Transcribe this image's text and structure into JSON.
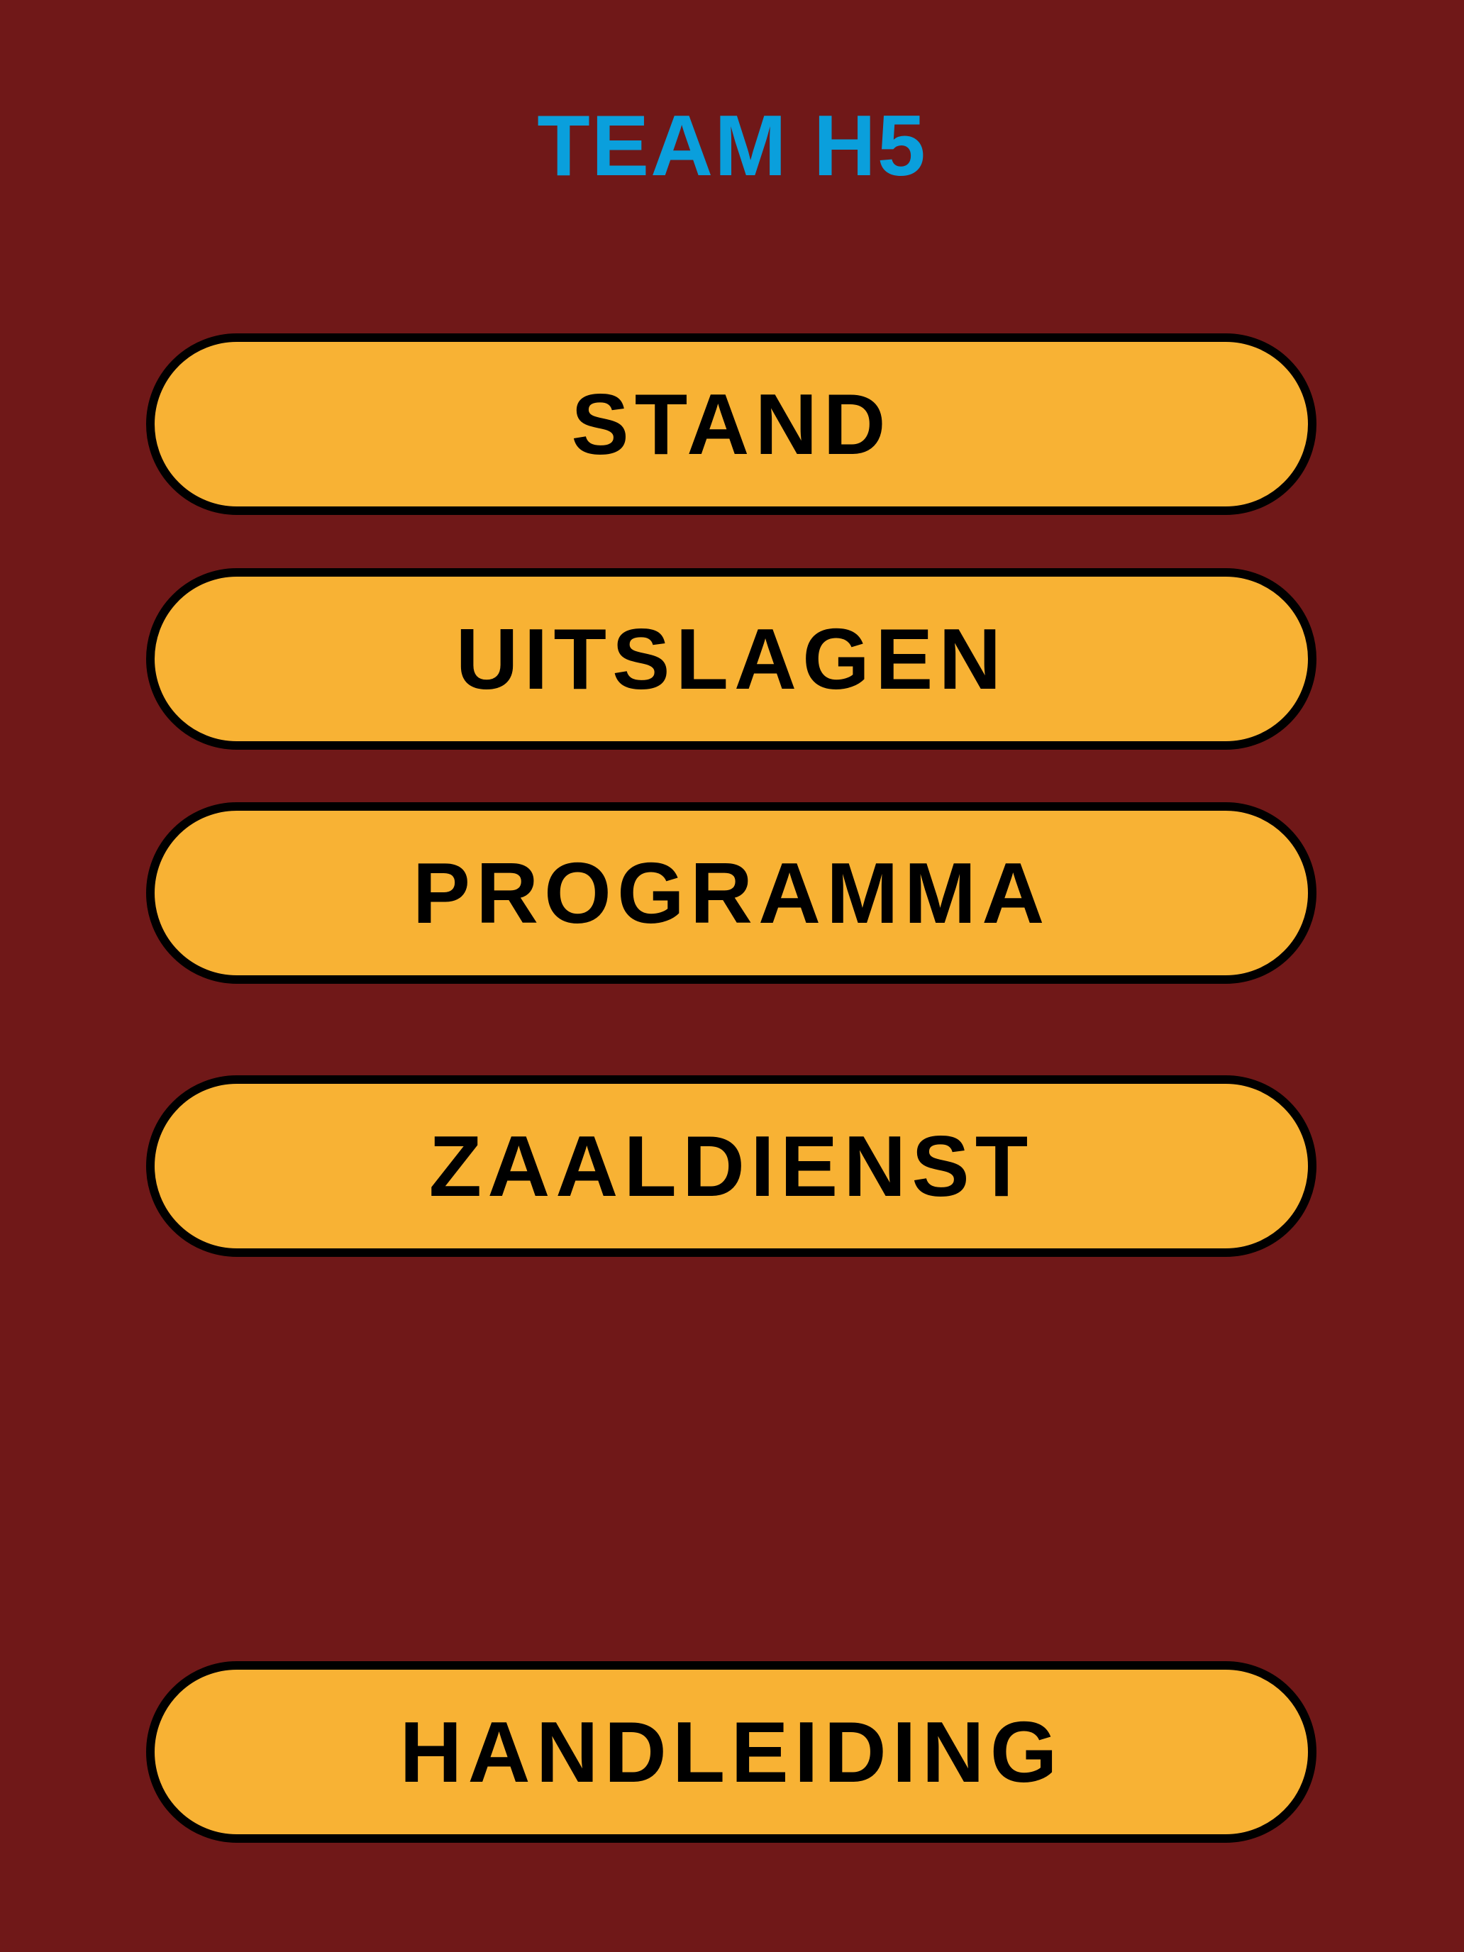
{
  "header": {
    "title": "TEAM H5"
  },
  "menu": {
    "items": [
      {
        "label": "STAND"
      },
      {
        "label": "UITSLAGEN"
      },
      {
        "label": "PROGRAMMA"
      },
      {
        "label": "ZAALDIENST"
      }
    ]
  },
  "footer": {
    "manual_label": "HANDLEIDING"
  },
  "colors": {
    "background": "#701818",
    "title": "#0a9fdc",
    "button_fill": "#f8b234",
    "button_border": "#000000",
    "button_text": "#000000"
  }
}
